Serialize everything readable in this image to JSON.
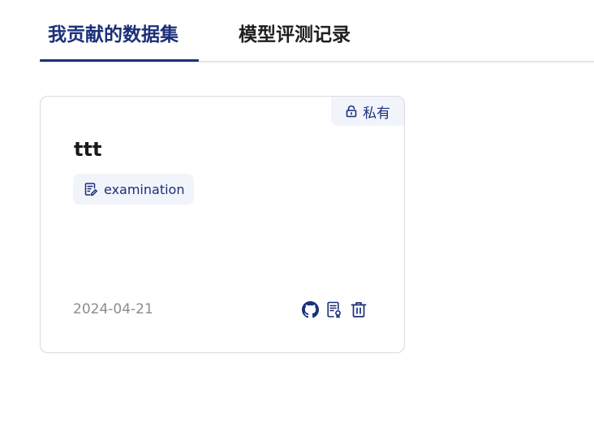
{
  "tabs": [
    {
      "label": "我贡献的数据集",
      "active": true
    },
    {
      "label": "模型评测记录",
      "active": false
    }
  ],
  "colors": {
    "accent": "#1b2f7a",
    "badge_bg": "#f2f4fb",
    "border": "#d9dadf",
    "date_text": "#8c8c8c"
  },
  "card": {
    "badge": {
      "icon": "lock-icon",
      "label": "私有"
    },
    "title": "ttt",
    "tag": {
      "icon": "edit-document-icon",
      "label": "examination"
    },
    "date": "2024-04-21",
    "actions": [
      {
        "icon": "github-icon"
      },
      {
        "icon": "document-icon"
      },
      {
        "icon": "trash-icon"
      }
    ]
  }
}
